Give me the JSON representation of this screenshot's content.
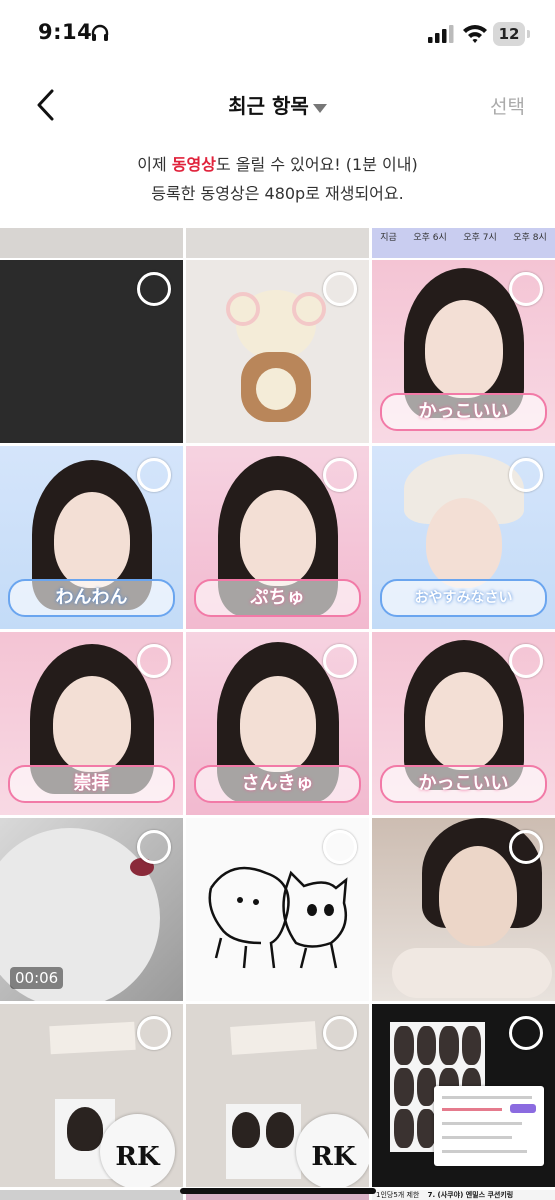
{
  "status_bar": {
    "time": "9:14",
    "battery": "12"
  },
  "nav": {
    "title": "최근 항목",
    "select_label": "선택"
  },
  "notice": {
    "line1_before": "이제 ",
    "line1_highlight": "동영상",
    "line1_after": "도 올릴 수 있어요! (1분 이내)",
    "line2": "등록한 동영상은 480p로 재생되어요."
  },
  "top_strip_labels": [
    "지금",
    "오후 6시",
    "오후 7시",
    "오후 8시"
  ],
  "grid_items": [
    {
      "kind": "photo"
    },
    {
      "kind": "photo"
    },
    {
      "kind": "photo"
    },
    {
      "kind": "photo"
    },
    {
      "kind": "photo"
    },
    {
      "kind": "photo"
    },
    {
      "kind": "photo"
    },
    {
      "kind": "photo"
    },
    {
      "kind": "photo"
    },
    {
      "kind": "video",
      "duration": "00:06"
    },
    {
      "kind": "photo"
    },
    {
      "kind": "photo"
    },
    {
      "kind": "photo"
    },
    {
      "kind": "photo"
    },
    {
      "kind": "photo"
    }
  ],
  "sticker_texts": [
    "かっこいい",
    "わんわん",
    "ぷちゅ",
    "おやすみなさい",
    "崇拝",
    "さんきゅ",
    "かっこいい"
  ],
  "badge_texts": [
    "RK",
    "RK"
  ],
  "bottom_peek_texts": [
    "1인당5개 제한",
    "7. (사쿠야) 엔밀스 쿠션키링"
  ],
  "colors": {
    "highlight": "#e0223b",
    "select_gray": "#aaaaaa"
  }
}
